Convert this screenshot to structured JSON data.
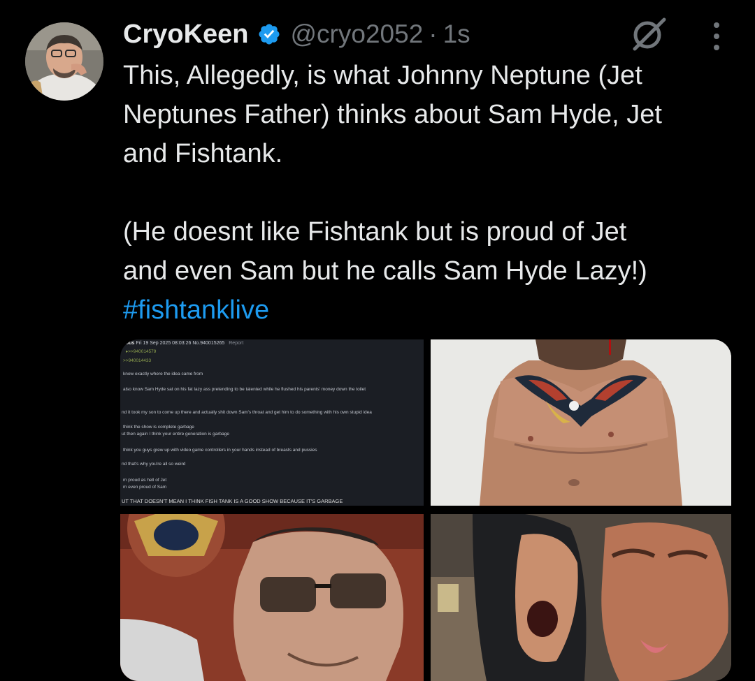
{
  "author": {
    "name": "CryoKeen",
    "handle": "@cryo2052",
    "separator": "·",
    "time": "1s"
  },
  "icons": {
    "verified": "verified-badge-icon",
    "grok": "grok-icon",
    "more": "more-options-icon"
  },
  "colors": {
    "background": "#000000",
    "text": "#e7e9ea",
    "muted": "#71767b",
    "accent": "#1d9bf0"
  },
  "tweet": {
    "line1": "This, Allegedly, is what Johnny Neptune (Jet",
    "line2": "Neptunes Father) thinks about Sam Hyde, Jet",
    "line3": "and Fishtank.",
    "line4": "(He doesnt like Fishtank but is proud of Jet",
    "line5": "and even Sam but he calls Sam Hyde Lazy!)",
    "hashtag": "#fishtanklive"
  },
  "media": {
    "post_screenshot": {
      "header_name": "ous",
      "header_date": "Fri 19 Sep 2025 08:03:26 No.940015265",
      "header_report": "Report",
      "quote_a": "▸>>940014579",
      "quote_b": ">>940014433",
      "lines": [
        "know exactly where the idea came from",
        "also know Sam Hyde sat on his fat lazy ass pretending to be talented while he flushed his parents' money down the toilet",
        "nd it took my son to come up there and actually shit down Sam's throat and get him to do something with his own stupid idea",
        "think the show is complete garbage",
        "ut then again I think your entire generation is garbage",
        "think you guys grew up with video game controllers in your hands instead of breasts and pussies",
        "nd that's why you're all so weird",
        "m proud as hell of Jet",
        "m even proud of Sam",
        "UT THAT DOESN'T MEAN I THINK FISH TANK IS A GOOD SHOW BECAUSE IT'S GARBAGE"
      ]
    }
  }
}
